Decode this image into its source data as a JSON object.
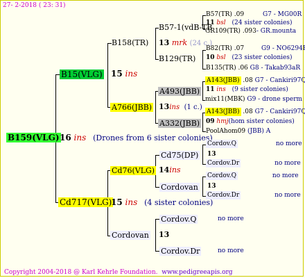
{
  "header": {
    "date": "27- 2-2018 ( 23: 31)"
  },
  "footer": {
    "copyright": "Copyright 2004-2018 @ Karl Kehrle Foundation.",
    "site": "www.pedigreeapis.org"
  },
  "colors": {
    "green": "#33ff33",
    "yellow": "#ffff00",
    "gray": "#c0c0c0",
    "pale": "#eeeeff",
    "red": "#cc0000",
    "navy": "#000080"
  },
  "root": {
    "name": "B159(VLG)",
    "gen": "16",
    "ins": "ins",
    "note": "(Drones from 6 sister colonies)"
  },
  "b15": {
    "name": "B15(VLG)",
    "gen": "15",
    "ins": "ins"
  },
  "cd717": {
    "name": "Cd717(VLG)",
    "gen": "15",
    "ins": "ins",
    "note": "(4 sister colonies)"
  },
  "b158": {
    "name": "B158(TR)"
  },
  "a766": {
    "name": "A766(JBB)",
    "gen": "13",
    "ins": "ins",
    "note": "(1 c.)"
  },
  "cd76": {
    "name": "Cd76(VLG)",
    "gen": "14",
    "ins": "ins"
  },
  "cordovan3": {
    "name": "Cordovan",
    "gen": "13"
  },
  "b57": {
    "name": "B57-1(vdB-TB",
    "gen": "13",
    "mrk": "mrk",
    "note": "(24 c.)"
  },
  "b129": {
    "name": "B129(TR)"
  },
  "a493": {
    "name": "A493(JBB)",
    "gen": "11",
    "ins": "ins"
  },
  "a332": {
    "name": "A332(JBB)"
  },
  "cd75": {
    "name": "Cd75(DP)",
    "gen": "13"
  },
  "cordovan4": {
    "name": "Cordovan",
    "gen": "13"
  },
  "cordovq": {
    "name": "Cordov.Q",
    "more": "no more"
  },
  "cordovdr": {
    "name": "Cordov.Dr",
    "more": "no more"
  },
  "g5": [
    {
      "name": "B57(TR)",
      "num": ".09",
      "right": "G7 - MG00R"
    },
    {
      "prefix": "11",
      "ins": "bsl",
      "note": "(24 sister colonies)"
    },
    {
      "name": "GR109(TR)",
      "num": ".093",
      "right": "- GR.mounta"
    },
    {
      "name": "B82(TR)",
      "num": ".07",
      "right": "G9 - NO6294R"
    },
    {
      "prefix": "10",
      "ins": "bsl",
      "note": "(23 sister colonies)"
    },
    {
      "name": "B135(TR)",
      "num": ".06",
      "right": "G8 - Takab93aR"
    },
    {
      "name": "A143(JBB)",
      "num": ".08",
      "right": "G7 - Cankiri97Q"
    },
    {
      "prefix": "11",
      "ins": "ins",
      "note": "(9 sister colonies)"
    },
    {
      "name": "mix11(MBK)",
      "num": "",
      "right": "G9 - drone sperm"
    },
    {
      "name": "A143(JBB)",
      "num": ".08",
      "right": "G7 - Cankiri97Q"
    },
    {
      "prefix": "09",
      "ins": "hmj",
      "note": "(hom sister colonies)"
    },
    {
      "name": "PoolAhom09",
      "num": "",
      "right": "(JBB) A"
    },
    {
      "name": "Cordov.Q",
      "num": "",
      "right": "no more"
    },
    {
      "prefix": "13",
      "ins": "",
      "note": ""
    },
    {
      "name": "Cordov.Dr",
      "num": "",
      "right": "no more"
    },
    {
      "name": "Cordov.Q",
      "num": "",
      "right": "no more"
    },
    {
      "prefix": "13",
      "ins": "",
      "note": ""
    },
    {
      "name": "Cordov.Dr",
      "num": "",
      "right": "no more"
    }
  ]
}
